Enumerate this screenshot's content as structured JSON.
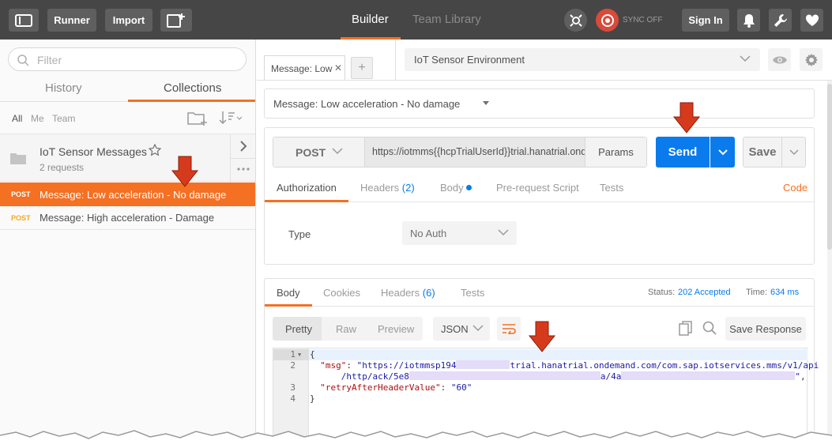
{
  "topbar": {
    "runner": "Runner",
    "import": "Import",
    "builder": "Builder",
    "team_library": "Team Library",
    "sync": "SYNC OFF",
    "sign_in": "Sign In"
  },
  "sidebar": {
    "filter_placeholder": "Filter",
    "tabs": [
      "History",
      "Collections"
    ],
    "scope": [
      "All",
      "Me",
      "Team"
    ],
    "collection": {
      "name": "IoT Sensor Messages",
      "count": "2 requests"
    },
    "requests": [
      {
        "method": "POST",
        "name": "Message: Low acceleration - No damage",
        "active": true
      },
      {
        "method": "POST",
        "name": "Message: High acceleration - Damage",
        "active": false
      }
    ]
  },
  "main": {
    "open_tab": "Message: Low",
    "environment": "IoT Sensor Environment",
    "request_name": "Message: Low acceleration - No damage",
    "method": "POST",
    "url": "https://iotmms{{hcpTrialUserId}}trial.hanatrial.ondemand.com",
    "params": "Params",
    "send": "Send",
    "save": "Save",
    "subtabs": {
      "authorization": "Authorization",
      "headers": "Headers",
      "headers_count": "(2)",
      "body": "Body",
      "prerequest": "Pre-request Script",
      "tests": "Tests",
      "code": "Code"
    },
    "auth": {
      "type_label": "Type",
      "type_value": "No Auth"
    }
  },
  "response": {
    "tabs": {
      "body": "Body",
      "cookies": "Cookies",
      "headers": "Headers",
      "headers_count": "(6)",
      "tests": "Tests"
    },
    "status_label": "Status:",
    "status_value": "202 Accepted",
    "time_label": "Time:",
    "time_value": "634 ms",
    "views": [
      "Pretty",
      "Raw",
      "Preview"
    ],
    "format": "JSON",
    "save_response": "Save Response",
    "code": {
      "line_numbers": [
        "1",
        "2",
        "",
        "3",
        "4"
      ],
      "brace_open": "{",
      "msg_key": "\"msg\"",
      "msg_val_a": "\"https://iotmmsp194",
      "msg_val_b": "trial.hanatrial.ondemand.com/com.sap.iotservices.mms/v1/api",
      "msg_val_c": "/http/ack/5e8",
      "msg_val_d": "a/4a",
      "msg_val_e": "\"",
      "retry_key": "\"retryAfterHeaderValue\"",
      "retry_val": "\"60\"",
      "brace_close": "}"
    }
  },
  "colors": {
    "accent": "#f47023",
    "primary": "#097bed",
    "topbar": "#464646"
  }
}
